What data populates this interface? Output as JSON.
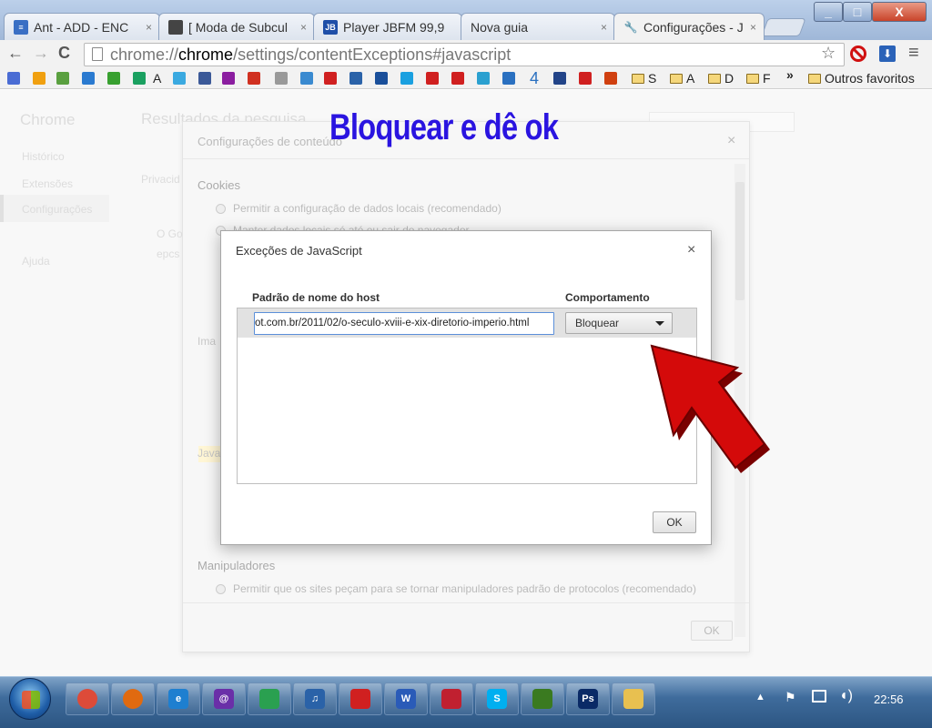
{
  "browser": {
    "tabs": [
      {
        "label": "Ant - ADD - ENC",
        "favicon_color": "#3a6fc4"
      },
      {
        "label": "[ Moda de Subcul",
        "favicon_color": "#444444"
      },
      {
        "label": "Player JBFM 99,9",
        "favicon_color": "#1f4fa8",
        "favicon_text": "JB"
      },
      {
        "label": "Nova guia"
      },
      {
        "label": "Configurações - J",
        "favicon_text": "🔧"
      }
    ],
    "address": {
      "prefix": "chrome://",
      "host": "chrome",
      "path": "/settings/contentExceptions#javascript"
    },
    "window_buttons": {
      "minimize": "_",
      "maximize": "□",
      "close": "X"
    }
  },
  "bookmarks": {
    "icon_colors": [
      "#4a6cd4",
      "#f0a010",
      "#5aa040",
      "#2a7ad0",
      "#38a030",
      "#1aa060",
      "#3aa9e0",
      "#3b5998",
      "#8b1ea0",
      "#d03020",
      "#999999",
      "#3a8ad0",
      "#d02020",
      "#2a62a8",
      "#1a4f9a",
      "#1aa0e0",
      "#d02020",
      "#d02020",
      "#2aa0d0",
      "#2a70c0",
      "#224488",
      "#d02020",
      "#d04010"
    ],
    "labels_inline": {
      "a1": "A",
      "i4": "4"
    },
    "folders": [
      "S",
      "A",
      "D",
      "F"
    ],
    "more": "»",
    "other": "Outros favoritos"
  },
  "annotation": {
    "text": "Bloquear e dê ok",
    "color": "#2a14e0",
    "arrow_color": "#d40a0a"
  },
  "background": {
    "nav": [
      "Chrome",
      "Histórico",
      "Extensões",
      "Configurações",
      "Ajuda"
    ],
    "search_title": "Resultados da pesquisa",
    "privacy": "Privacid",
    "faint_rows": [
      "O Go",
      "epcs",
      "Ima",
      "Java"
    ]
  },
  "settings_dialog": {
    "title": "Configurações de conteúdo",
    "cookies_heading": "Cookies",
    "cookie_opt1": "Permitir a configuração de dados locais (recomendado)",
    "cookie_opt2": "Manter dados locais só até eu sair do navegador",
    "handlers_heading": "Manipuladores",
    "handlers_opt": "Permitir que os sites peçam para se tornar manipuladores padrão de protocolos (recomendado)",
    "ok": "OK"
  },
  "js_dialog": {
    "title": "Exceções de JavaScript",
    "col_host": "Padrão de nome do host",
    "col_behavior": "Comportamento",
    "host_value": "ot.com.br/2011/02/o-seculo-xviii-e-xix-diretorio-imperio.html",
    "behavior": "Bloquear",
    "ok": "OK"
  },
  "taskbar": {
    "clock": "22:56",
    "apps": [
      {
        "name": "chrome",
        "color": "#dd4b39",
        "text": ""
      },
      {
        "name": "firefox",
        "color": "#e06a10",
        "text": ""
      },
      {
        "name": "ie",
        "color": "#1e7fd0",
        "text": "e"
      },
      {
        "name": "app4",
        "color": "#6a2fa8",
        "text": "@"
      },
      {
        "name": "app5",
        "color": "#2aa050",
        "text": ""
      },
      {
        "name": "app6",
        "color": "#2a62a8",
        "text": "♫"
      },
      {
        "name": "app7",
        "color": "#d02020",
        "text": ""
      },
      {
        "name": "word",
        "color": "#2a5bb8",
        "text": "W"
      },
      {
        "name": "app9",
        "color": "#c02030",
        "text": ""
      },
      {
        "name": "skype",
        "color": "#00aff0",
        "text": "S"
      },
      {
        "name": "app11",
        "color": "#3a7a20",
        "text": ""
      },
      {
        "name": "photoshop",
        "color": "#0a2a66",
        "text": "Ps"
      },
      {
        "name": "explorer",
        "color": "#e8c050",
        "text": ""
      }
    ]
  }
}
